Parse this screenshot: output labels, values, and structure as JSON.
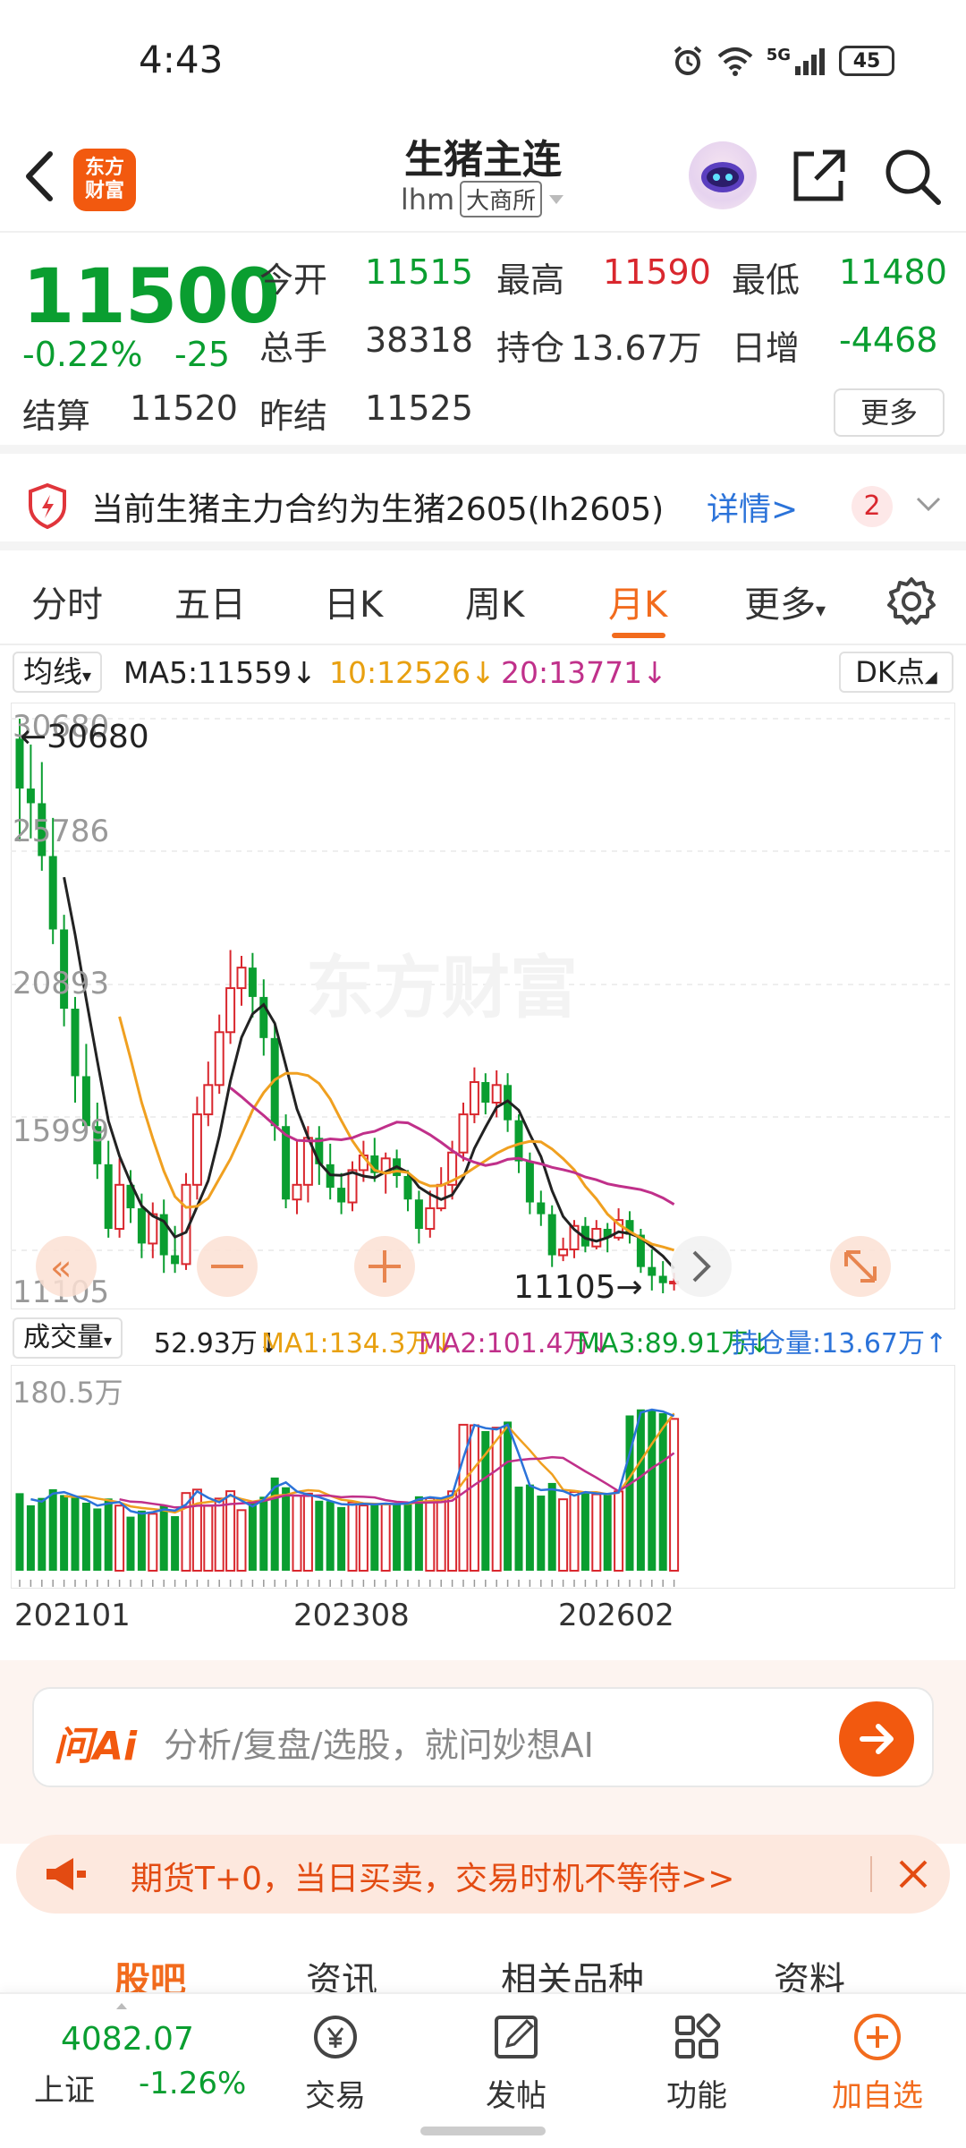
{
  "status": {
    "time": "4:43",
    "network": "5G",
    "battery": "45"
  },
  "header": {
    "logo_line1": "东方",
    "logo_line2": "财富",
    "title": "生猪主连",
    "symbol": "lhm",
    "exchange": "大商所"
  },
  "quote": {
    "price": "11500",
    "change_pct": "-0.22%",
    "change": "-25",
    "open_label": "今开",
    "open": "11515",
    "high_label": "最高",
    "high": "11590",
    "low_label": "最低",
    "low": "11480",
    "volume_label": "总手",
    "volume": "38318",
    "oi_label": "持仓",
    "oi": "13.67万",
    "daily_inc_label": "日增",
    "daily_inc": "-4468",
    "settle_label": "结算",
    "settle": "11520",
    "prev_settle_label": "昨结",
    "prev_settle": "11525",
    "more_label": "更多"
  },
  "notice": {
    "text": "当前生猪主力合约为生猪2605(lh2605)",
    "link": "详情>",
    "badge": "2"
  },
  "tabs": [
    "分时",
    "五日",
    "日K",
    "周K",
    "月K",
    "更多"
  ],
  "active_tab": "月K",
  "ma": {
    "selector": "均线",
    "ma5": "MA5:11559↓",
    "ma10": "10:12526↓",
    "ma20": "20:13771↓",
    "dk": "DK点"
  },
  "kline": {
    "y_labels": [
      "30680",
      "25786",
      "20893",
      "15999",
      "11105"
    ],
    "max_marker": "←30680",
    "min_marker": "11105→",
    "watermark": "东方财富"
  },
  "volume": {
    "selector": "成交量",
    "current": "52.93万↓",
    "ma1": "MA1:134.3万↓",
    "ma2": "MA2:101.4万↓",
    "ma3": "MA3:89.91万↓",
    "oi": "持仓量:13.67万↑",
    "max_label": "180.5万"
  },
  "dates": [
    "202101",
    "202308",
    "202602"
  ],
  "ai": {
    "logo": "问Ai",
    "placeholder": "分析/复盘/选股，就问妙想AI"
  },
  "promo": {
    "text": "期货T+0，当日买卖，交易时机不等待>>"
  },
  "bottom_tabs": [
    "股吧",
    "资讯",
    "相关品种",
    "资料"
  ],
  "index": {
    "value": "4082.07",
    "name": "上证",
    "change": "-1.26%"
  },
  "bottom_nav": {
    "trade": "交易",
    "post": "发帖",
    "func": "功能",
    "add": "加自选"
  },
  "colors": {
    "up": "#d9272e",
    "down": "#0a9e30",
    "accent": "#f26b1d",
    "ma5": "#222222",
    "ma10": "#f0a020",
    "ma20": "#c0308a"
  },
  "chart_data": {
    "type": "candlestick",
    "period": "monthly",
    "ylim": [
      11105,
      30680
    ],
    "candles": [
      [
        30000,
        28300,
        30680,
        26500
      ],
      [
        28300,
        27800,
        29800,
        26600
      ],
      [
        27800,
        26000,
        29200,
        25500
      ],
      [
        26000,
        23500,
        27300,
        23000
      ],
      [
        23500,
        20800,
        24000,
        20200
      ],
      [
        20800,
        18500,
        21200,
        17600
      ],
      [
        18500,
        16800,
        19600,
        16500
      ],
      [
        16800,
        15500,
        17600,
        15000
      ],
      [
        15500,
        13300,
        16300,
        13000
      ],
      [
        13300,
        14800,
        15700,
        13000
      ],
      [
        14800,
        14000,
        15300,
        13500
      ],
      [
        14000,
        12800,
        14500,
        12300
      ],
      [
        12800,
        13800,
        14200,
        12300
      ],
      [
        13800,
        12400,
        14300,
        11800
      ],
      [
        12400,
        12100,
        13400,
        11800
      ],
      [
        12100,
        14800,
        15200,
        11900
      ],
      [
        14800,
        17200,
        17800,
        14300
      ],
      [
        17200,
        18200,
        19000,
        16800
      ],
      [
        18200,
        20000,
        20600,
        17900
      ],
      [
        20000,
        21500,
        22800,
        19600
      ],
      [
        21500,
        22200,
        22600,
        20900
      ],
      [
        22200,
        21200,
        22700,
        20500
      ],
      [
        21200,
        19800,
        21800,
        19200
      ],
      [
        19800,
        16800,
        20300,
        16300
      ],
      [
        16800,
        14300,
        17200,
        14000
      ],
      [
        14300,
        14800,
        16300,
        13800
      ],
      [
        14800,
        16400,
        16800,
        14200
      ],
      [
        16400,
        15500,
        16800,
        14800
      ],
      [
        15500,
        14700,
        16200,
        14300
      ],
      [
        14700,
        14200,
        15200,
        13800
      ],
      [
        14200,
        15300,
        15600,
        13900
      ],
      [
        15300,
        15800,
        16300,
        14900
      ],
      [
        15800,
        15200,
        16400,
        14900
      ],
      [
        15200,
        15700,
        15900,
        14500
      ],
      [
        15700,
        15100,
        16000,
        14700
      ],
      [
        15100,
        14300,
        15300,
        13900
      ],
      [
        14300,
        13300,
        14600,
        12800
      ],
      [
        13300,
        14000,
        14600,
        13000
      ],
      [
        14000,
        14800,
        15400,
        13900
      ],
      [
        14800,
        15900,
        16300,
        14300
      ],
      [
        15900,
        17200,
        17600,
        15600
      ],
      [
        17200,
        18300,
        18800,
        16900
      ],
      [
        18300,
        17600,
        18600,
        17200
      ],
      [
        17600,
        18200,
        18700,
        17100
      ],
      [
        18200,
        17000,
        18600,
        16600
      ],
      [
        17000,
        15600,
        17200,
        15200
      ],
      [
        15600,
        14200,
        15900,
        13800
      ],
      [
        14200,
        13800,
        14600,
        13400
      ],
      [
        13800,
        12400,
        14100,
        12000
      ],
      [
        12400,
        12600,
        13000,
        12200
      ],
      [
        12600,
        13400,
        13600,
        12300
      ],
      [
        13400,
        12700,
        13700,
        12500
      ],
      [
        12700,
        13300,
        13600,
        12600
      ],
      [
        13300,
        13000,
        13500,
        12500
      ],
      [
        13000,
        13600,
        14000,
        12900
      ],
      [
        13600,
        13100,
        13900,
        12800
      ],
      [
        13100,
        12000,
        13300,
        11800
      ],
      [
        12000,
        11700,
        12600,
        11200
      ],
      [
        11700,
        11450,
        12200,
        11105
      ],
      [
        11450,
        11500,
        11800,
        11200
      ]
    ],
    "volume_max": "180.5万"
  }
}
